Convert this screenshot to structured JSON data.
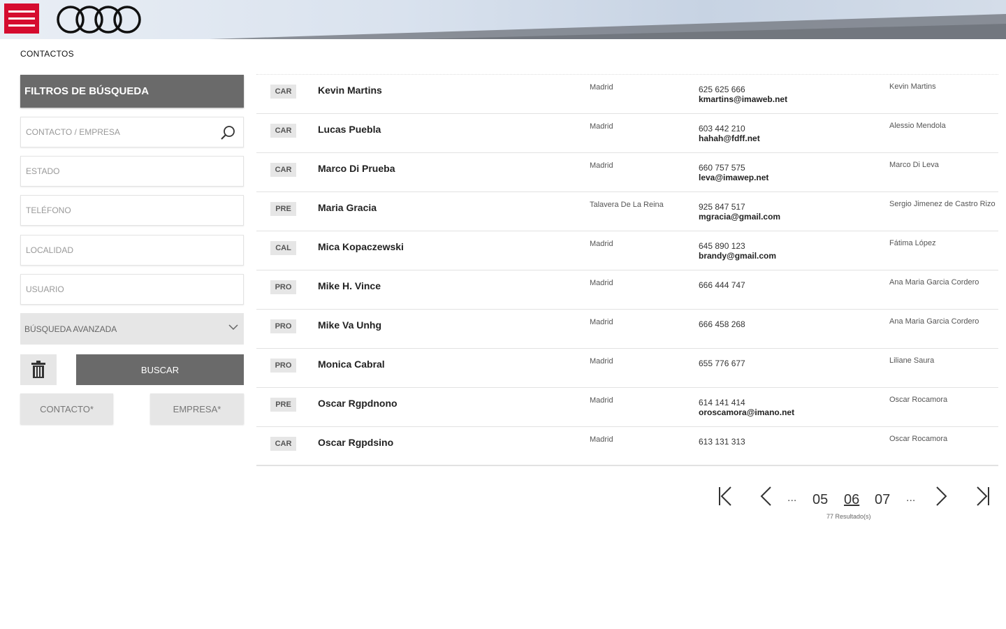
{
  "header": {
    "menu_icon": "hamburger-icon",
    "logo_icon": "four-rings-logo"
  },
  "page_title": "CONTACTOS",
  "filters": {
    "title": "FILTROS DE BÚSQUEDA",
    "contacto_placeholder": "CONTACTO / EMPRESA",
    "estado_placeholder": "ESTADO",
    "telefono_placeholder": "TELÉFONO",
    "localidad_placeholder": "LOCALIDAD",
    "usuario_placeholder": "USUARIO",
    "advanced_label": "BÚSQUEDA AVANZADA",
    "search_button": "BUSCAR",
    "contacto_button": "CONTACTO*",
    "empresa_button": "EMPRESA*"
  },
  "contacts": [
    {
      "type": "CAR",
      "name": "Kevin Martins",
      "city": "Madrid",
      "phone": "625 625 666",
      "email": "kmartins@imaweb.net",
      "user": "Kevin Martins"
    },
    {
      "type": "CAR",
      "name": "Lucas Puebla",
      "city": "Madrid",
      "phone": "603 442 210",
      "email": "hahah@fdff.net",
      "user": "Alessio Mendola"
    },
    {
      "type": "CAR",
      "name": "Marco Di Prueba",
      "city": "Madrid",
      "phone": "660 757 575",
      "email": "leva@imawep.net",
      "user": "Marco Di Leva"
    },
    {
      "type": "PRE",
      "name": "Maria Gracia",
      "city": "Talavera De La Reina",
      "phone": "925 847 517",
      "email": "mgracia@gmail.com",
      "user": "Sergio Jimenez de Castro Rizo"
    },
    {
      "type": "CAL",
      "name": "Mica Kopaczewski",
      "city": "Madrid",
      "phone": "645 890 123",
      "email": "brandy@gmail.com",
      "user": "Fátima López"
    },
    {
      "type": "PRO",
      "name": "Mike H. Vince",
      "city": "Madrid",
      "phone": "666 444 747",
      "email": "",
      "user": "Ana Maria Garcia Cordero"
    },
    {
      "type": "PRO",
      "name": "Mike Va Unhg",
      "city": "Madrid",
      "phone": "666 458 268",
      "email": "",
      "user": "Ana Maria Garcia Cordero"
    },
    {
      "type": "PRO",
      "name": "Monica Cabral",
      "city": "Madrid",
      "phone": "655 776 677",
      "email": "",
      "user": "Liliane Saura"
    },
    {
      "type": "PRE",
      "name": "Oscar Rgpdnono",
      "city": "Madrid",
      "phone": "614 141 414",
      "email": "oroscamora@imano.net",
      "user": "Oscar Rocamora"
    },
    {
      "type": "CAR",
      "name": "Oscar Rgpdsino",
      "city": "Madrid",
      "phone": "613 131 313",
      "email": "",
      "user": "Oscar Rocamora"
    }
  ],
  "pagination": {
    "pages": [
      "05",
      "06",
      "07"
    ],
    "current": "06",
    "ellipsis": "...",
    "results_label": "77 Resultado(s)"
  }
}
